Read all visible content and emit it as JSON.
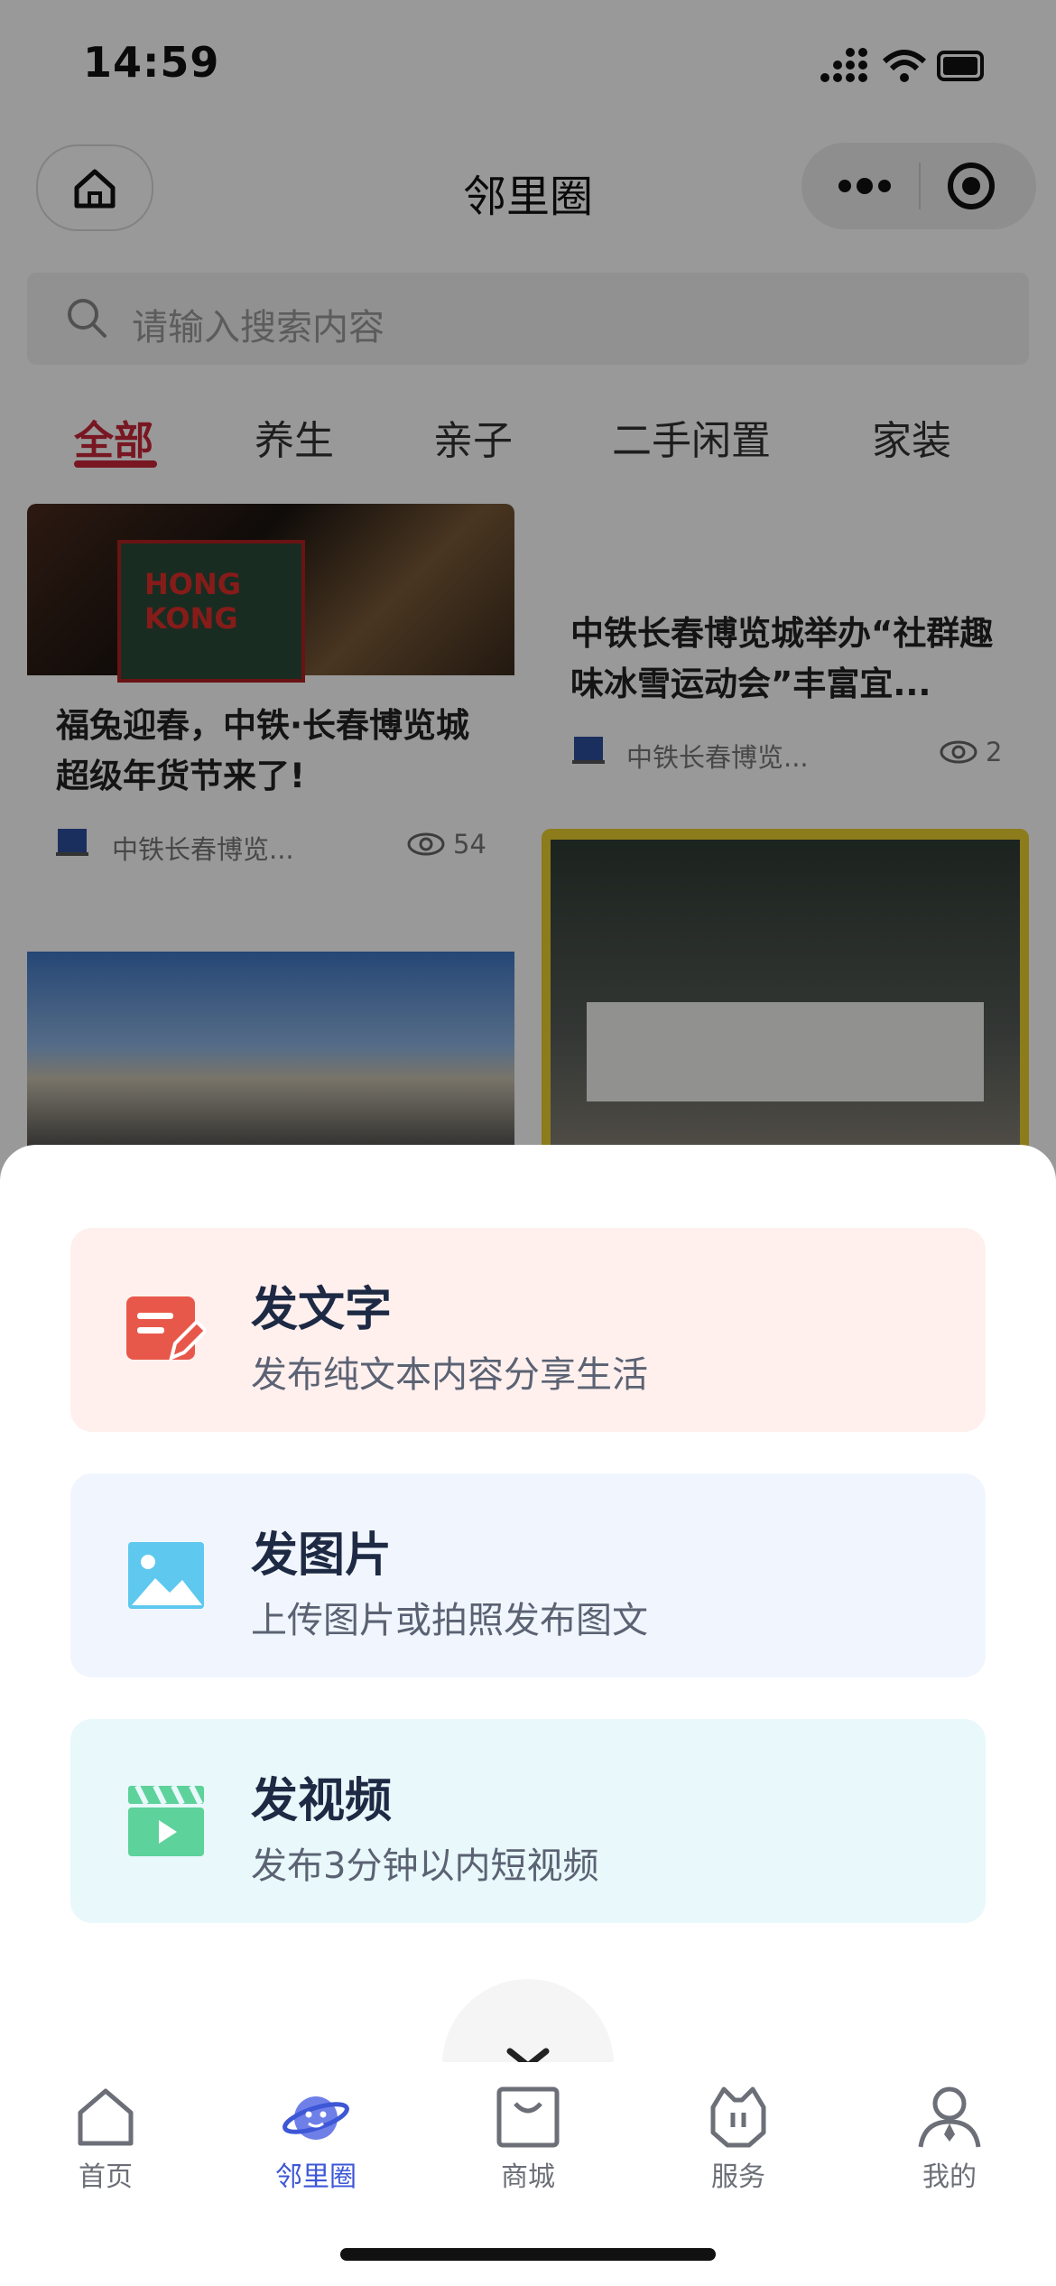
{
  "status_bar": {
    "time": "14:59"
  },
  "header": {
    "title": "邻里圈"
  },
  "search": {
    "placeholder": "请输入搜索内容"
  },
  "tabs": [
    {
      "label": "全部",
      "active": true
    },
    {
      "label": "养生"
    },
    {
      "label": "亲子"
    },
    {
      "label": "二手闲置"
    },
    {
      "label": "家装"
    }
  ],
  "feed": [
    {
      "title": "福兔迎春，中铁·长春博览城超级年货节来了!",
      "author": "中铁长春博览...",
      "views": "54"
    },
    {
      "title": "中铁长春博览城举办“社群趣味冰雪运动会”丰富宜...",
      "author": "中铁长春博览...",
      "views": "2"
    }
  ],
  "sheet": {
    "options": [
      {
        "title": "发文字",
        "desc": "发布纯文本内容分享生活",
        "bg": "#fff0ee",
        "icon": "text-edit-icon"
      },
      {
        "title": "发图片",
        "desc": "上传图片或拍照发布图文",
        "bg": "#f1f6fe",
        "icon": "image-icon"
      },
      {
        "title": "发视频",
        "desc": "发布3分钟以内短视频",
        "bg": "#e8f8fb",
        "icon": "video-clapper-icon"
      }
    ]
  },
  "tabbar": {
    "items": [
      {
        "label": "首页",
        "icon": "home-icon"
      },
      {
        "label": "邻里圈",
        "icon": "planet-icon",
        "active": true
      },
      {
        "label": "商城",
        "icon": "shopping-bag-icon"
      },
      {
        "label": "服务",
        "icon": "service-icon"
      },
      {
        "label": "我的",
        "icon": "profile-icon"
      }
    ]
  },
  "colors": {
    "accent_red": "#c9273a",
    "accent_blue": "#3d57d6"
  }
}
